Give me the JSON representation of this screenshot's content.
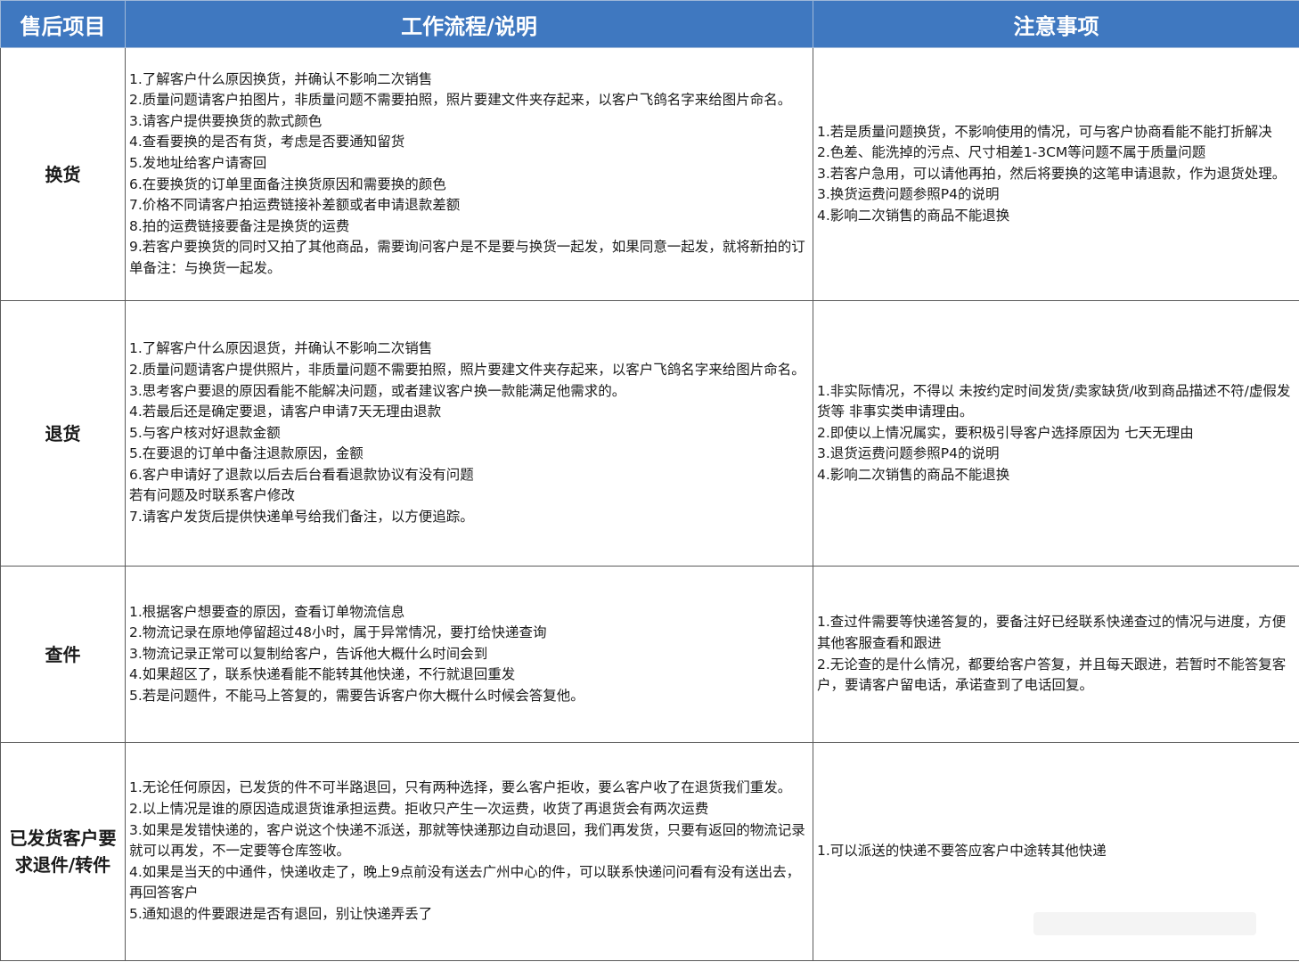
{
  "header": {
    "col_item": "售后项目",
    "col_flow": "工作流程/说明",
    "col_note": "注意事项"
  },
  "rows": [
    {
      "item": "换货",
      "flow": [
        "1.了解客户什么原因换货，并确认不影响二次销售",
        "2.质量问题请客户拍图片，非质量问题不需要拍照，照片要建文件夹存起来，以客户飞鸽名字来给图片命名。",
        "3.请客户提供要换货的款式颜色",
        "4.查看要换的是否有货，考虑是否要通知留货",
        "5.发地址给客户请寄回",
        "6.在要换货的订单里面备注换货原因和需要换的颜色",
        "7.价格不同请客户拍运费链接补差额或者申请退款差额",
        "8.拍的运费链接要备注是换货的运费",
        "9.若客户要换货的同时又拍了其他商品，需要询问客户是不是要与换货一起发，如果同意一起发，就将新拍的订单备注：与换货一起发。"
      ],
      "notes": [
        "1.若是质量问题换货，不影响使用的情况，可与客户协商看能不能打折解决",
        "2.色差、能洗掉的污点、尺寸相差1-3CM等问题不属于质量问题",
        "3.若客户急用，可以请他再拍，然后将要换的这笔申请退款，作为退货处理。",
        "3.换货运费问题参照P4的说明",
        "4.影响二次销售的商品不能退换"
      ]
    },
    {
      "item": "退货",
      "flow": [
        "1.了解客户什么原因退货，并确认不影响二次销售",
        "2.质量问题请客户提供照片，非质量问题不需要拍照，照片要建文件夹存起来，以客户飞鸽名字来给图片命名。",
        "3.思考客户要退的原因看能不能解决问题，或者建议客户换一款能满足他需求的。",
        "4.若最后还是确定要退，请客户申请7天无理由退款",
        "5.与客户核对好退款金额",
        "5.在要退的订单中备注退款原因，金额",
        "6.客户申请好了退款以后去后台看看退款协议有没有问题",
        "若有问题及时联系客户修改",
        "7.请客户发货后提供快递单号给我们备注，以方便追踪。"
      ],
      "notes": [
        "1.非实际情况，不得以 未按约定时间发货/卖家缺货/收到商品描述不符/虚假发货等 非事实类申请理由。",
        "2.即使以上情况属实，要积极引导客户选择原因为 七天无理由",
        "3.退货运费问题参照P4的说明",
        "4.影响二次销售的商品不能退换"
      ]
    },
    {
      "item": "查件",
      "flow": [
        "1.根据客户想要查的原因，查看订单物流信息",
        "2.物流记录在原地停留超过48小时，属于异常情况，要打给快递查询",
        "3.物流记录正常可以复制给客户，告诉他大概什么时间会到",
        "4.如果超区了，联系快递看能不能转其他快递，不行就退回重发",
        "5.若是问题件，不能马上答复的，需要告诉客户你大概什么时候会答复他。"
      ],
      "notes": [
        "1.查过件需要等快递答复的，要备注好已经联系快递查过的情况与进度，方便其他客服查看和跟进",
        "2.无论查的是什么情况，都要给客户答复，并且每天跟进，若暂时不能答复客户，要请客户留电话，承诺查到了电话回复。"
      ]
    },
    {
      "item": "已发货客户要求退件/转件",
      "flow": [
        "1.无论任何原因，已发货的件不可半路退回，只有两种选择，要么客户拒收，要么客户收了在退货我们重发。",
        "2.以上情况是谁的原因造成退货谁承担运费。拒收只产生一次运费，收货了再退货会有两次运费",
        "3.如果是发错快递的，客户说这个快递不派送，那就等快递那边自动退回，我们再发货，只要有返回的物流记录就可以再发，不一定要等仓库签收。",
        "4.如果是当天的中通件，快递收走了，晚上9点前没有送去广州中心的件，可以联系快递问问看有没有送出去，再回答客户",
        "5.通知退的件要跟进是否有退回，别让快递弄丢了"
      ],
      "notes": [
        "1.可以派送的快递不要答应客户中途转其他快递"
      ]
    }
  ]
}
